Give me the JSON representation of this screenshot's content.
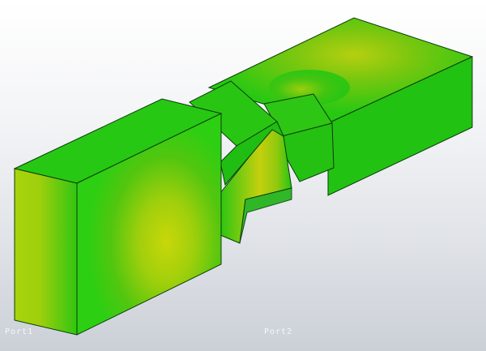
{
  "scene": {
    "labels": {
      "left": "Port1",
      "right": "Port2"
    },
    "colors": {
      "field_base": "#22cc11",
      "field_dark": "#1da60f",
      "field_hot": "#c8d80a",
      "field_warm": "#a6d00c",
      "background_top": "#ffffff",
      "background_bottom": "#cbd0d7"
    }
  }
}
